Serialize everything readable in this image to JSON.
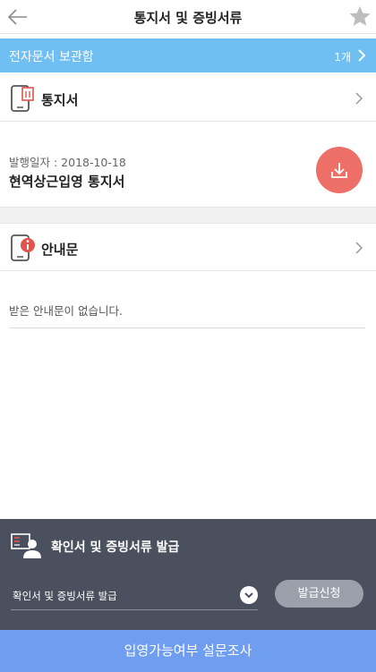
{
  "header": {
    "title": "통지서 및 증빙서류"
  },
  "archive": {
    "label": "전자문서 보관함",
    "count": "1개"
  },
  "notice_section": {
    "label": "통지서",
    "item": {
      "date": "발행일자 : 2018-10-18",
      "name": "현역상근입영 통지서"
    }
  },
  "guide_section": {
    "label": "안내문",
    "empty_message": "받은 안내문이 없습니다."
  },
  "issue_panel": {
    "title": "확인서 및 증빙서류 발급",
    "select_value": "확인서 및 증빙서류 발급",
    "apply_label": "발급신청"
  },
  "survey": {
    "label": "입영가능여부 설문조사"
  },
  "colors": {
    "archive_bar": "#6fbff2",
    "download_button": "#ee6f67",
    "panel_bg": "#4a505e",
    "survey_bar": "#6f9df0"
  }
}
